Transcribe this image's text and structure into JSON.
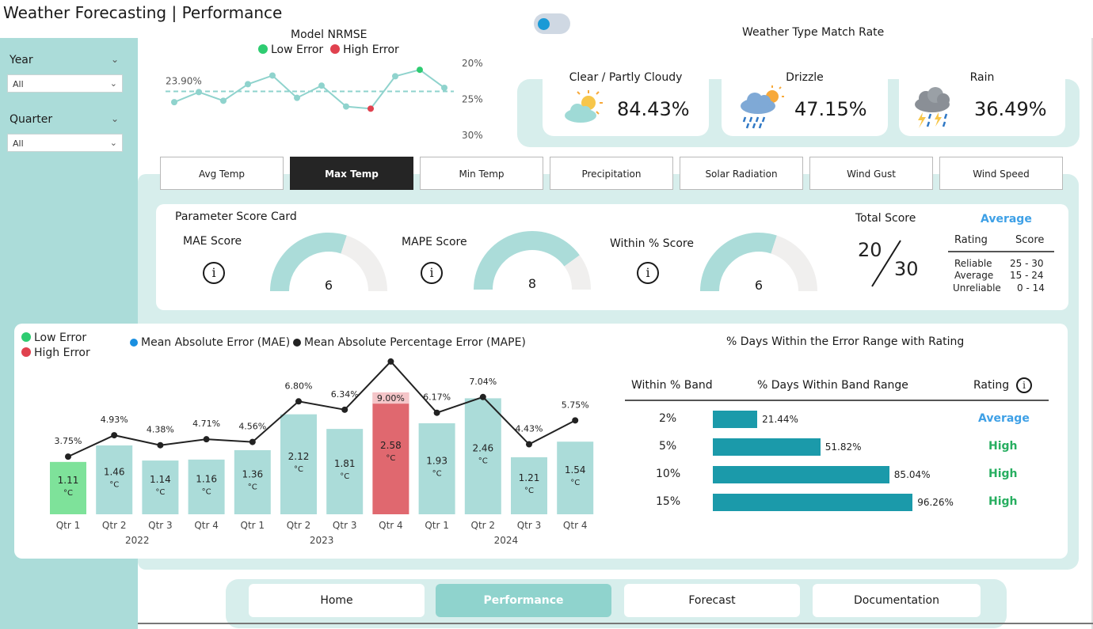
{
  "title": "Weather Forecasting | Performance",
  "filters": {
    "year": {
      "label": "Year",
      "value": "All"
    },
    "quarter": {
      "label": "Quarter",
      "value": "All"
    }
  },
  "nrmse": {
    "title": "Model NRMSE",
    "legend_low": "Low Error",
    "legend_high": "High Error",
    "avg_label": "23.90%",
    "y_ticks": [
      "20%",
      "25%",
      "30%"
    ],
    "values": [
      25.4,
      24.0,
      25.2,
      22.9,
      21.7,
      24.8,
      23.1,
      26.0,
      26.3,
      21.8,
      20.9,
      23.4
    ],
    "low_index": 10,
    "high_index": 8,
    "colors": {
      "low": "#2ecc71",
      "high": "#e0414e",
      "line": "#8fd3cd"
    }
  },
  "weather_match": {
    "title": "Weather Type Match Rate",
    "cards": [
      {
        "label": "Clear / Partly Cloudy",
        "value": "84.43%",
        "icon": "sun-cloud-icon"
      },
      {
        "label": "Drizzle",
        "value": "47.15%",
        "icon": "drizzle-icon"
      },
      {
        "label": "Rain",
        "value": "36.49%",
        "icon": "storm-icon"
      }
    ]
  },
  "tabs": [
    "Avg Temp",
    "Max Temp",
    "Min Temp",
    "Precipitation",
    "Solar Radiation",
    "Wind Gust",
    "Wind Speed"
  ],
  "active_tab": 1,
  "score_card": {
    "title": "Parameter Score Card",
    "mae_label": "MAE Score",
    "mape_label": "MAPE Score",
    "within_label": "Within % Score",
    "info_glyph": "i",
    "mae_score": 6,
    "mape_score": 8,
    "within_score": 6,
    "gauge_max": 10,
    "total_label": "Total Score",
    "total_value": "20",
    "total_max": "30",
    "rating_word": "Average",
    "rating_header": "Rating",
    "score_header": "Score",
    "ratings": [
      {
        "name": "Reliable",
        "range": "25 - 30"
      },
      {
        "name": "Average",
        "range": "15 - 24"
      },
      {
        "name": "Unreliable",
        "range": "0 - 14"
      }
    ]
  },
  "bottom_legend": {
    "low": "Low Error",
    "high": "High Error",
    "mae": "Mean Absolute Error (MAE)",
    "mape": "Mean Absolute Percentage Error (MAPE)"
  },
  "chart_data": {
    "type": "bar",
    "categories": [
      "Qtr 1",
      "Qtr 2",
      "Qtr 3",
      "Qtr 4",
      "Qtr 1",
      "Qtr 2",
      "Qtr 3",
      "Qtr 4",
      "Qtr 1",
      "Qtr 2",
      "Qtr 3",
      "Qtr 4"
    ],
    "years": [
      "2022",
      "2023",
      "2024"
    ],
    "unit": "°C",
    "series": [
      {
        "name": "Mean Absolute Error (MAE)",
        "values": [
          1.11,
          1.46,
          1.14,
          1.16,
          1.36,
          2.12,
          1.81,
          2.58,
          1.93,
          2.46,
          1.21,
          1.54
        ]
      },
      {
        "name": "Mean Absolute Percentage Error (MAPE)",
        "values": [
          3.75,
          4.93,
          4.38,
          4.71,
          4.56,
          6.8,
          6.34,
          9.0,
          6.17,
          7.04,
          4.43,
          5.75
        ],
        "labels": [
          "3.75%",
          "4.93%",
          "4.38%",
          "4.71%",
          "4.56%",
          "6.80%",
          "6.34%",
          "9.00%",
          "6.17%",
          "7.04%",
          "4.43%",
          "5.75%"
        ]
      }
    ],
    "low_index": 0,
    "high_index": 7,
    "colors": {
      "bar": "#abdcd9",
      "low": "#7ee29a",
      "high": "#e0686f",
      "line": "#222222"
    }
  },
  "band_table": {
    "title": "% Days Within the Error Range with Rating",
    "col_band": "Within % Band",
    "col_days": "% Days Within Band Range",
    "col_rating": "Rating",
    "rows": [
      {
        "band": "2%",
        "value": 21.44,
        "label": "21.44%",
        "rating": "Average",
        "color": "#3ea0e6"
      },
      {
        "band": "5%",
        "value": 51.82,
        "label": "51.82%",
        "rating": "High",
        "color": "#27ae60"
      },
      {
        "band": "10%",
        "value": 85.04,
        "label": "85.04%",
        "rating": "High",
        "color": "#27ae60"
      },
      {
        "band": "15%",
        "value": 96.26,
        "label": "96.26%",
        "rating": "High",
        "color": "#27ae60"
      }
    ],
    "bar_color": "#1b9aaa"
  },
  "nav": [
    "Home",
    "Performance",
    "Forecast",
    "Documentation"
  ],
  "active_nav": 1
}
